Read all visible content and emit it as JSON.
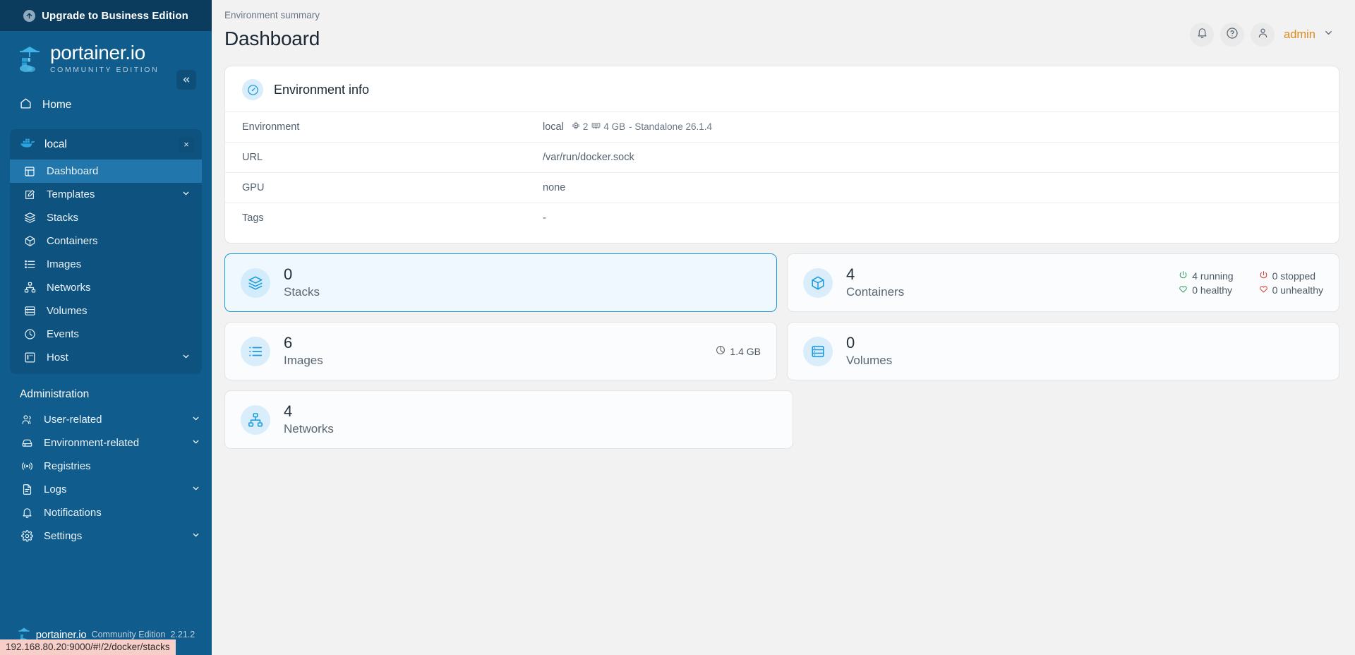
{
  "sidebar": {
    "upgrade_label": "Upgrade to Business Edition",
    "logo_title": "portainer.io",
    "logo_subtitle": "COMMUNITY EDITION",
    "home_label": "Home",
    "environment": {
      "name": "local",
      "close_label": "×"
    },
    "env_items": [
      {
        "label": "Dashboard",
        "icon": "dashboard-icon",
        "active": true,
        "chevron": false
      },
      {
        "label": "Templates",
        "icon": "template-icon",
        "active": false,
        "chevron": true
      },
      {
        "label": "Stacks",
        "icon": "stacks-icon",
        "active": false,
        "chevron": false
      },
      {
        "label": "Containers",
        "icon": "container-icon",
        "active": false,
        "chevron": false
      },
      {
        "label": "Images",
        "icon": "images-icon",
        "active": false,
        "chevron": false
      },
      {
        "label": "Networks",
        "icon": "networks-icon",
        "active": false,
        "chevron": false
      },
      {
        "label": "Volumes",
        "icon": "volumes-icon",
        "active": false,
        "chevron": false
      },
      {
        "label": "Events",
        "icon": "events-clock-icon",
        "active": false,
        "chevron": false
      },
      {
        "label": "Host",
        "icon": "host-icon",
        "active": false,
        "chevron": true
      }
    ],
    "administration_title": "Administration",
    "admin_items": [
      {
        "label": "User-related",
        "icon": "users-icon",
        "chevron": true
      },
      {
        "label": "Environment-related",
        "icon": "environment-icon",
        "chevron": true
      },
      {
        "label": "Registries",
        "icon": "registries-icon",
        "chevron": false
      },
      {
        "label": "Logs",
        "icon": "logs-icon",
        "chevron": true
      },
      {
        "label": "Notifications",
        "icon": "bell-icon",
        "chevron": false
      },
      {
        "label": "Settings",
        "icon": "gear-icon",
        "chevron": true
      }
    ],
    "footer": {
      "name": "portainer.io",
      "edition": "Community Edition",
      "version": "2.21.2"
    }
  },
  "status_bar": {
    "url": "192.168.80.20:9000/#!/2/docker/stacks"
  },
  "header": {
    "breadcrumb": "Environment summary",
    "title": "Dashboard",
    "user": "admin"
  },
  "environment_info": {
    "card_title": "Environment info",
    "rows": [
      {
        "key": "Environment",
        "value": "local",
        "cpu": "2",
        "memory": "4 GB",
        "suffix": "- Standalone 26.1.4"
      },
      {
        "key": "URL",
        "value": "/var/run/docker.sock"
      },
      {
        "key": "GPU",
        "value": "none"
      },
      {
        "key": "Tags",
        "value": "-"
      }
    ]
  },
  "stats": {
    "stacks": {
      "count": "0",
      "label": "Stacks",
      "icon": "stacks-icon",
      "hovered": true
    },
    "containers": {
      "count": "4",
      "label": "Containers",
      "icon": "container-icon",
      "running": "4 running",
      "stopped": "0 stopped",
      "healthy": "0 healthy",
      "unhealthy": "0 unhealthy"
    },
    "images": {
      "count": "6",
      "label": "Images",
      "icon": "images-icon",
      "size": "1.4 GB"
    },
    "volumes": {
      "count": "0",
      "label": "Volumes",
      "icon": "volumes-icon"
    },
    "networks": {
      "count": "4",
      "label": "Networks",
      "icon": "networks-icon"
    }
  },
  "colors": {
    "sidebar_bg": "#105c8c",
    "banner_bg": "#0b3c5d",
    "accent": "#1f9bda",
    "active_nav": "#2176ab",
    "user_name": "#d98a1f",
    "green": "#2c9d5f",
    "red": "#d0342c"
  }
}
